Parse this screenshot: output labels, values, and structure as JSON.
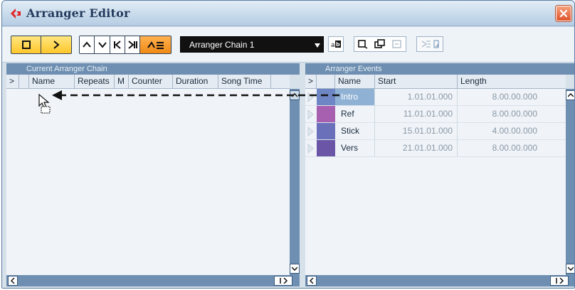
{
  "window": {
    "title": "Arranger Editor"
  },
  "toolbar": {
    "chain_name": "Arranger Chain 1",
    "buttons": [
      "stop-button",
      "play-button",
      "move-up-button",
      "move-down-button",
      "previous-button",
      "next-button",
      "jump-mode-button"
    ]
  },
  "left_pane": {
    "header": "Current Arranger Chain",
    "columns": [
      ">",
      "Name",
      "Repeats",
      "M",
      "Counter",
      "Duration",
      "Song Time"
    ]
  },
  "right_pane": {
    "header": "Arranger Events",
    "columns": [
      ">",
      "",
      "Name",
      "Start",
      "Length"
    ],
    "rows": [
      {
        "name": "Intro",
        "start": "1.01.01.000",
        "length": "8.00.00.000",
        "color": "#6f86c4",
        "selected": true
      },
      {
        "name": "Ref",
        "start": "11.01.01.000",
        "length": "8.00.00.000",
        "color": "#a75fb0",
        "selected": false
      },
      {
        "name": "Stick",
        "start": "15.01.01.000",
        "length": "4.00.00.000",
        "color": "#6b70bb",
        "selected": false
      },
      {
        "name": "Vers",
        "start": "21.01.01.000",
        "length": "8.00.00.000",
        "color": "#6a55a6",
        "selected": false
      }
    ]
  },
  "colors": {
    "accent_yellow": "#ffc72b",
    "accent_orange": "#f08a16",
    "pane_header": "#6e8fb1",
    "selection": "#8eb1d4"
  }
}
